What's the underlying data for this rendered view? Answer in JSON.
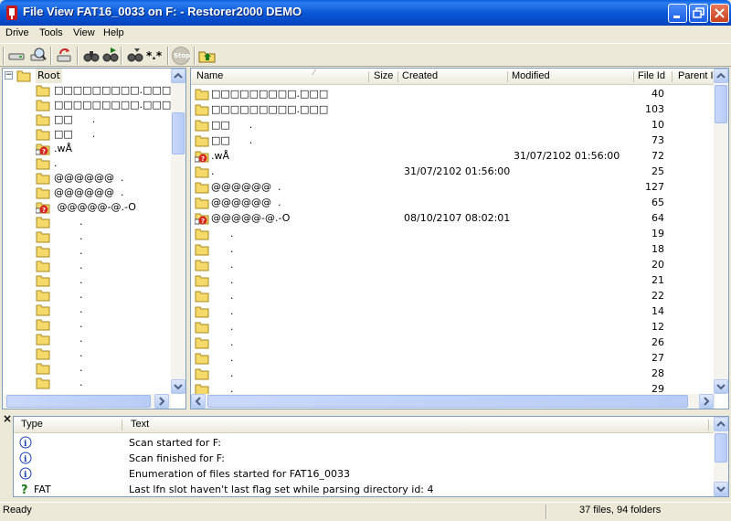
{
  "window": {
    "title": "File View FAT16_0033 on F: - Restorer2000 DEMO"
  },
  "menu": [
    "Drive",
    "Tools",
    "View",
    "Help"
  ],
  "toolbar": {
    "icons": [
      "drive-icon",
      "scan-icon",
      "refresh-icon",
      "find-icon",
      "find-next-icon",
      "filter-icon",
      "mask-icon",
      "stop-icon",
      "up-folder-icon"
    ],
    "mask_label": "*.*",
    "stop_label": "Stop"
  },
  "tree": {
    "root_label": "Root",
    "items": [
      {
        "name": "□□□□□□□□□.□□□",
        "type": "folder"
      },
      {
        "name": "□□□□□□□□□.□□□",
        "type": "folder"
      },
      {
        "name": "□□      .",
        "type": "folder"
      },
      {
        "name": "□□      .",
        "type": "folder"
      },
      {
        "name": ".wÅ",
        "type": "deleted"
      },
      {
        "name": ".",
        "type": "folder"
      },
      {
        "name": "@@@@@@  .",
        "type": "folder"
      },
      {
        "name": "@@@@@@  .",
        "type": "folder"
      },
      {
        "name": " @@@@@-@.-O",
        "type": "deleted"
      },
      {
        "name": "        .",
        "type": "folder"
      },
      {
        "name": "        .",
        "type": "folder"
      },
      {
        "name": "        .",
        "type": "folder"
      },
      {
        "name": "        .",
        "type": "folder"
      },
      {
        "name": "        .",
        "type": "folder"
      },
      {
        "name": "        .",
        "type": "folder"
      },
      {
        "name": "        .",
        "type": "folder"
      },
      {
        "name": "        .",
        "type": "folder"
      },
      {
        "name": "        .",
        "type": "folder"
      },
      {
        "name": "        .",
        "type": "folder"
      },
      {
        "name": "        .",
        "type": "folder"
      },
      {
        "name": "        .",
        "type": "folder"
      }
    ]
  },
  "list": {
    "columns": [
      "Name",
      "Size",
      "Created",
      "Modified",
      "File Id",
      "Parent I"
    ],
    "rows": [
      {
        "name": "□□□□□□□□□.□□□",
        "type": "folder",
        "created": "",
        "modified": "",
        "id": "40"
      },
      {
        "name": "□□□□□□□□□.□□□",
        "type": "folder",
        "created": "",
        "modified": "",
        "id": "103"
      },
      {
        "name": "□□      .",
        "type": "folder",
        "created": "",
        "modified": "",
        "id": "10"
      },
      {
        "name": "□□      .",
        "type": "folder",
        "created": "",
        "modified": "",
        "id": "73"
      },
      {
        "name": ".wÅ",
        "type": "deleted",
        "created": "",
        "modified": "31/07/2102 01:56:00",
        "id": "72"
      },
      {
        "name": ".",
        "type": "folder",
        "created": "31/07/2102 01:56:00",
        "modified": "",
        "id": "25"
      },
      {
        "name": "@@@@@@  .",
        "type": "folder",
        "created": "",
        "modified": "",
        "id": "127"
      },
      {
        "name": "@@@@@@  .",
        "type": "folder",
        "created": "",
        "modified": "",
        "id": "65"
      },
      {
        "name": "@@@@@-@.-O",
        "type": "deleted",
        "created": "08/10/2107 08:02:01",
        "modified": "",
        "id": "64"
      },
      {
        "name": "      .",
        "type": "folder",
        "created": "",
        "modified": "",
        "id": "19"
      },
      {
        "name": "      .",
        "type": "folder",
        "created": "",
        "modified": "",
        "id": "18"
      },
      {
        "name": "      .",
        "type": "folder",
        "created": "",
        "modified": "",
        "id": "20"
      },
      {
        "name": "      .",
        "type": "folder",
        "created": "",
        "modified": "",
        "id": "21"
      },
      {
        "name": "      .",
        "type": "folder",
        "created": "",
        "modified": "",
        "id": "22"
      },
      {
        "name": "      .",
        "type": "folder",
        "created": "",
        "modified": "",
        "id": "14"
      },
      {
        "name": "      .",
        "type": "folder",
        "created": "",
        "modified": "",
        "id": "12"
      },
      {
        "name": "      .",
        "type": "folder",
        "created": "",
        "modified": "",
        "id": "26"
      },
      {
        "name": "      .",
        "type": "folder",
        "created": "",
        "modified": "",
        "id": "27"
      },
      {
        "name": "      .",
        "type": "folder",
        "created": "",
        "modified": "",
        "id": "28"
      },
      {
        "name": "      .",
        "type": "folder",
        "created": "",
        "modified": "",
        "id": "29"
      }
    ]
  },
  "log": {
    "close_label": "×",
    "columns": [
      "Type",
      "Text"
    ],
    "rows": [
      {
        "icon": "info-icon",
        "type": "",
        "text": "Scan started for F:"
      },
      {
        "icon": "info-icon",
        "type": "",
        "text": "Scan finished for F:"
      },
      {
        "icon": "info-icon",
        "type": "",
        "text": "Enumeration of files started for FAT16_0033"
      },
      {
        "icon": "question-icon",
        "type": "FAT",
        "text": "Last lfn slot haven't last flag set while parsing directory id: 4"
      }
    ]
  },
  "status": {
    "left": "Ready",
    "right": "37 files, 94 folders"
  },
  "colors": {
    "titlebar": "#0a58d6",
    "folder": "#f5d96b",
    "deleted_badge": "#d8251e",
    "info": "#1a3fb0"
  }
}
